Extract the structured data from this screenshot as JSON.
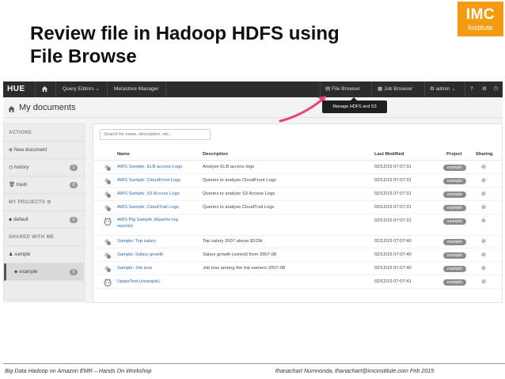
{
  "slide": {
    "title_line1": "Review file in Hadoop HDFS using",
    "title_line2": "File Browse",
    "logo_big": "IMC",
    "logo_small": "Institute",
    "footer_left": "Big Data Hadoop on Amazon EMR – Hands On Workshop",
    "footer_right": "thanachart Numnonda, thanachart@imcinstitute.com Feb 2015"
  },
  "hue": {
    "logo": "HUE",
    "nav": {
      "query_editors": "Query Editors ⌄",
      "metastore_manager": "Metastore Manager",
      "file_browser": "File Browser",
      "job_browser": "Job Browser",
      "admin": "admin ⌄"
    },
    "tooltip": "Manage HDFS and S3",
    "page_title": "My documents",
    "sidebar": {
      "actions": "ACTIONS",
      "new_document": "New document",
      "history": "history",
      "history_count": "1",
      "trash": "trash",
      "trash_count": "0",
      "my_projects": "MY PROJECTS",
      "default": "default",
      "default_count": "0",
      "shared_with_me": "SHARED WITH ME",
      "sample": "sample",
      "example": "example",
      "example_count": "9"
    },
    "search_placeholder": "Search for name, description, etc...",
    "table": {
      "headers": {
        "name": "Name",
        "description": "Description",
        "last_modified": "Last Modified",
        "project": "Project",
        "sharing": "Sharing"
      },
      "rows": [
        {
          "name": "AWS Sample: ELB access Logs",
          "description": "Analyze ELB access logs",
          "modified": "02/12/15 07:07:31",
          "project": "example"
        },
        {
          "name": "AWS Sample: CloudFront Logs",
          "description": "Queries to analyze CloudFront Logs",
          "modified": "02/12/15 07:07:31",
          "project": "example"
        },
        {
          "name": "AWS Sample: S3 Access Logs",
          "description": "Queries to analyze S3 Access Logs",
          "modified": "02/12/15 07:07:31",
          "project": "example"
        },
        {
          "name": "AWS Sample: CloudTrail Logs",
          "description": "Queries to analyze CloudTrail Logs",
          "modified": "02/12/15 07:07:31",
          "project": "example"
        },
        {
          "name_line1": "AWS Pig Sample (Apache log",
          "name_line2": "reports)",
          "description": "",
          "modified": "02/12/15 07:07:31",
          "project": "example"
        },
        {
          "name": "Sample: Top salary",
          "description": "Top salary 2007 above $100k",
          "modified": "02/12/15 07:07:40",
          "project": "example"
        },
        {
          "name": "Sample: Salary growth",
          "description": "Salary growth (sorted) from 2007-08",
          "modified": "02/12/15 07:07:40",
          "project": "example"
        },
        {
          "name": "Sample: Job loss",
          "description": "Job loss among the top earners 2007-08",
          "modified": "02/12/15 07:07:40",
          "project": "example"
        },
        {
          "name": "UpperText (example)",
          "description": "",
          "modified": "02/12/15 07:07:41",
          "project": "example"
        }
      ]
    }
  },
  "colors": {
    "nav_bg": "#2c2c2c",
    "logo_orange": "#f39c12",
    "arrow_pink": "#e8437a",
    "link_blue": "#2b6cb0"
  }
}
